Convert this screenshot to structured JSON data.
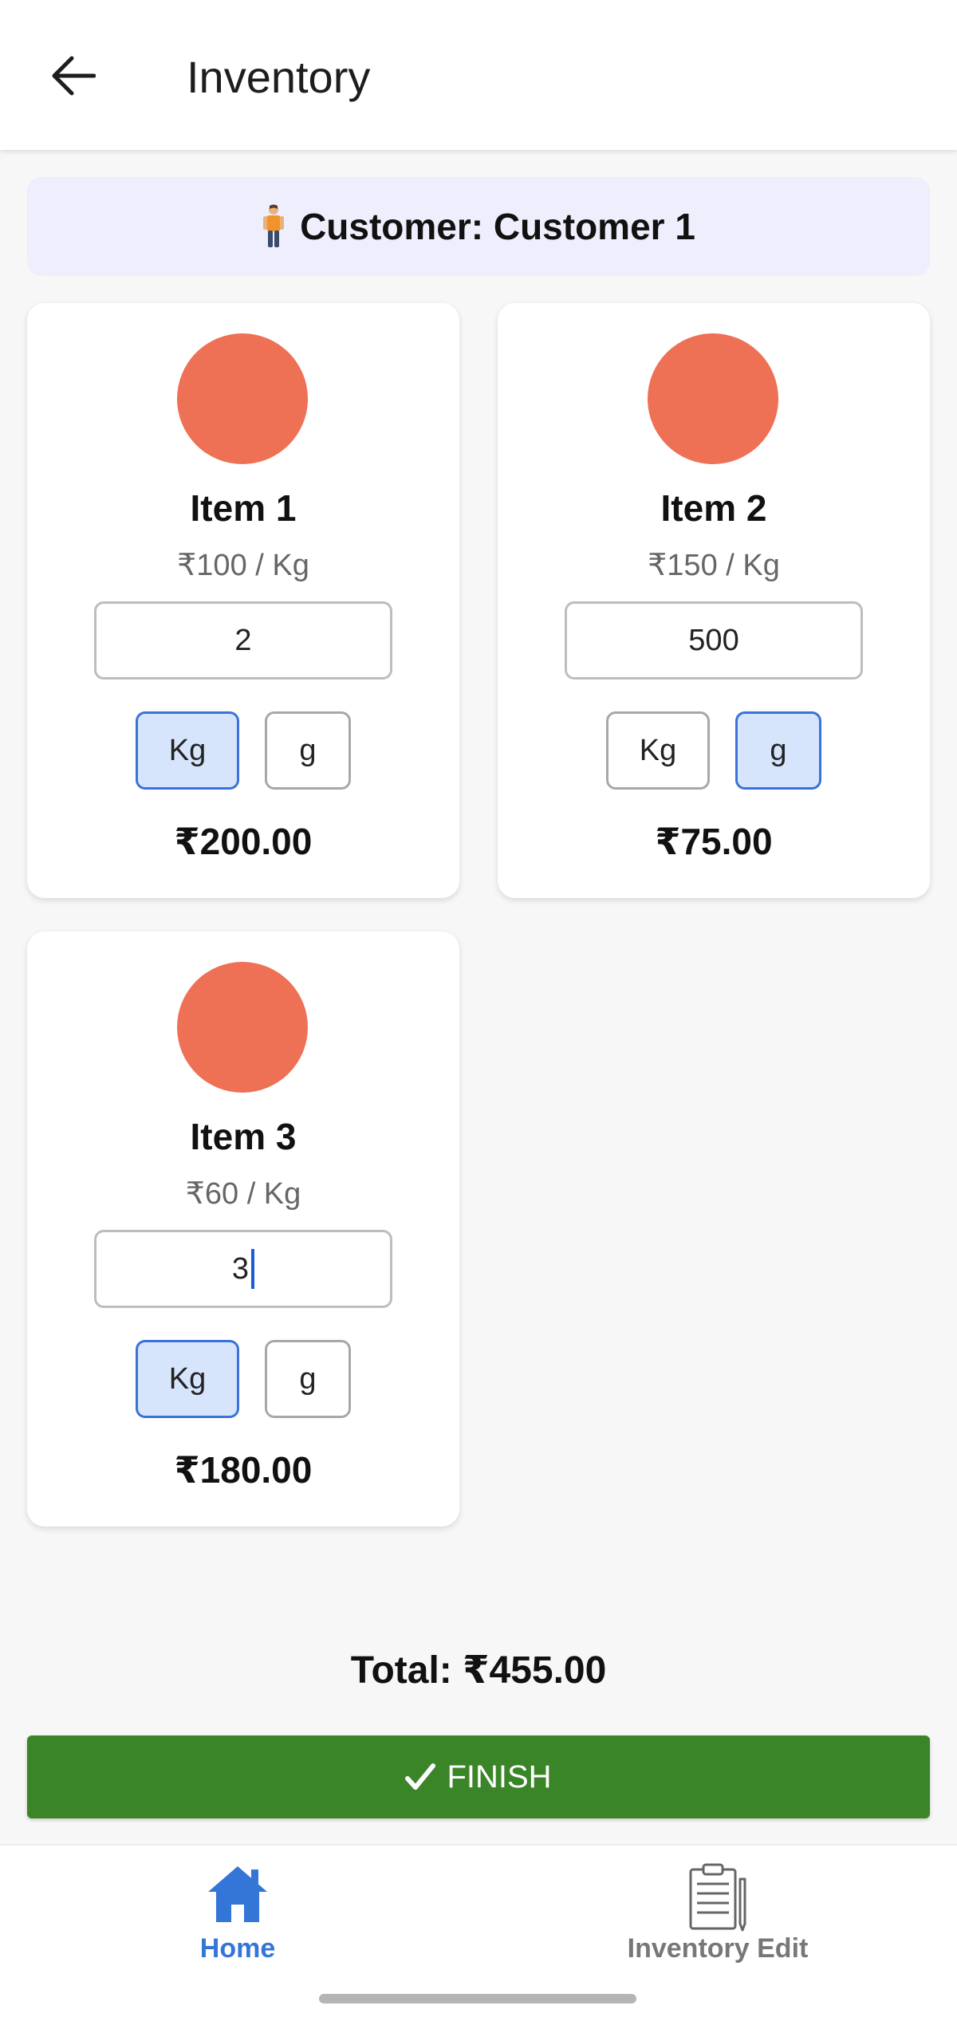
{
  "app_bar": {
    "title": "Inventory"
  },
  "customer_banner": {
    "text": "Customer: Customer 1",
    "icon": "person-standing-icon"
  },
  "items": [
    {
      "name": "Item 1",
      "price": "₹100 / Kg",
      "quantity": "2",
      "unit_kg_label": "Kg",
      "unit_g_label": "g",
      "selected_unit": "Kg",
      "subtotal": "₹200.00",
      "color": "#ee7055"
    },
    {
      "name": "Item 2",
      "price": "₹150 / Kg",
      "quantity": "500",
      "unit_kg_label": "Kg",
      "unit_g_label": "g",
      "selected_unit": "g",
      "subtotal": "₹75.00",
      "color": "#ee7055"
    },
    {
      "name": "Item 3",
      "price": "₹60 / Kg",
      "quantity": "3",
      "unit_kg_label": "Kg",
      "unit_g_label": "g",
      "selected_unit": "Kg",
      "subtotal": "₹180.00",
      "color": "#ee7055"
    }
  ],
  "total": "Total: ₹455.00",
  "finish_button": {
    "label": "FINISH",
    "icon": "checkmark-icon",
    "color": "#3a8527"
  },
  "bottom_nav": {
    "items": [
      {
        "label": "Home",
        "icon": "home-icon",
        "active": true
      },
      {
        "label": "Inventory Edit",
        "icon": "clipboard-icon",
        "active": false
      }
    ],
    "active_color": "#3475d8"
  }
}
